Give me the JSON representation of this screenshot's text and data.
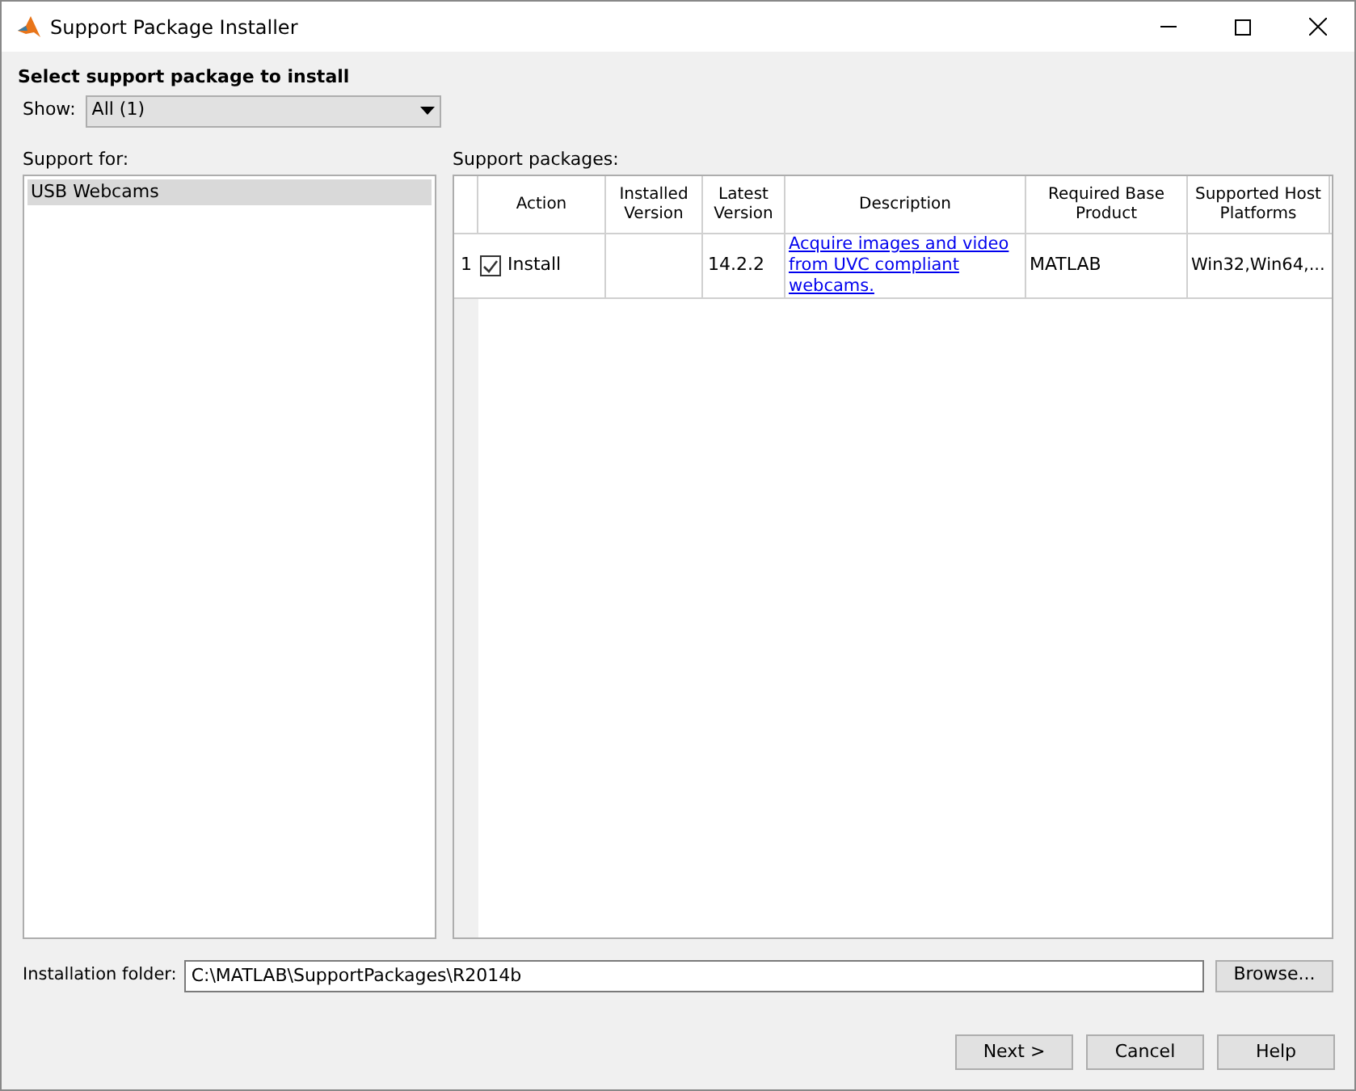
{
  "window": {
    "title": "Support Package Installer"
  },
  "heading": "Select support package to install",
  "show": {
    "label": "Show:",
    "value": "All (1)"
  },
  "support_for": {
    "label": "Support for:",
    "items": [
      {
        "label": "USB Webcams",
        "selected": true
      }
    ]
  },
  "packages": {
    "label": "Support packages:",
    "columns": [
      "Action",
      "Installed Version",
      "Latest Version",
      "Description",
      "Required Base Product",
      "Supported Host Platforms"
    ],
    "rows": [
      {
        "number": "1",
        "checked": true,
        "action": "Install",
        "installed_version": "",
        "latest_version": "14.2.2",
        "description": "Acquire images and video from UVC compliant webcams.",
        "required_base_product": "MATLAB",
        "supported_host_platforms": "Win32,Win64,..."
      }
    ]
  },
  "folder": {
    "label": "Installation folder:",
    "value": "C:\\MATLAB\\SupportPackages\\R2014b",
    "browse": "Browse..."
  },
  "buttons": [
    "Next >",
    "Cancel",
    "Help"
  ]
}
